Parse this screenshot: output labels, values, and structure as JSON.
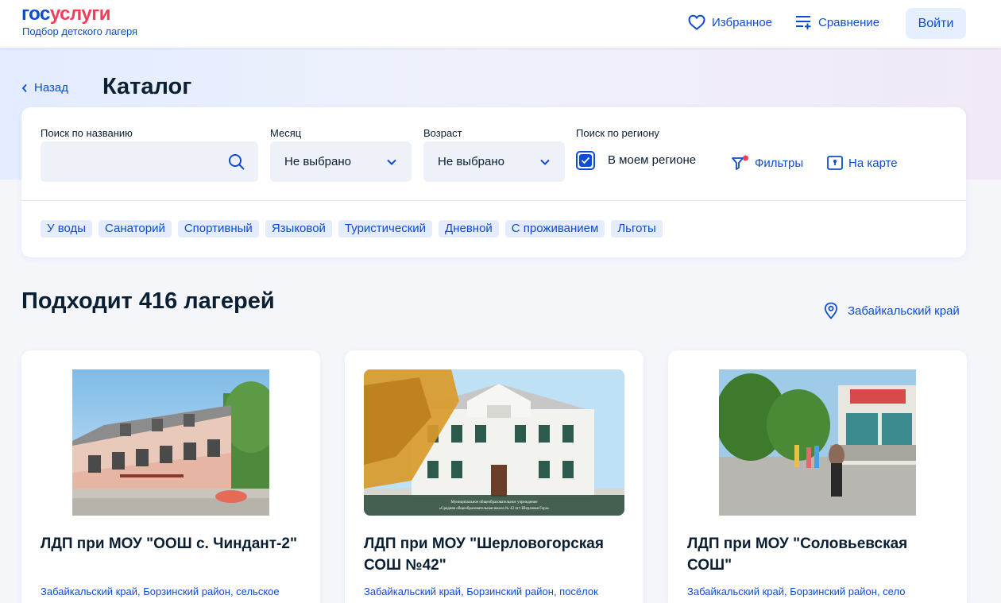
{
  "header": {
    "logo_gos": "гос",
    "logo_uslugi": "услуги",
    "subtitle": "Подбор детского лагеря",
    "favorites_label": "Избранное",
    "compare_label": "Сравнение",
    "login_label": "Войти"
  },
  "nav": {
    "back_label": "Назад",
    "page_title": "Каталог"
  },
  "filters": {
    "search_label": "Поиск по названию",
    "search_value": "",
    "month_label": "Месяц",
    "month_value": "Не выбрано",
    "age_label": "Возраст",
    "age_value": "Не выбрано",
    "region_label": "Поиск по региону",
    "region_checkbox_label": "В моем регионе",
    "region_checked": true,
    "filters_label": "Фильтры",
    "map_label": "На карте",
    "tags": [
      "У воды",
      "Санаторий",
      "Спортивный",
      "Языковой",
      "Туристический",
      "Дневной",
      "С проживанием",
      "Льготы"
    ]
  },
  "results": {
    "title": "Подходит 416 лагерей",
    "region": "Забайкальский край"
  },
  "cards": [
    {
      "title": "ЛДП при МОУ \"ООШ с. Чиндант-2\"",
      "address": "Забайкальский край, Борзинский район, сельское"
    },
    {
      "title": "ЛДП при МОУ \"Шерловогорская СОШ №42\"",
      "address": "Забайкальский край, Борзинский район, посёлок",
      "image_caption_1": "Муниципальное общеобразовательное учреждение",
      "image_caption_2": "«Средняя общеобразовательная школа № 42 пгт Шерловая Гора»"
    },
    {
      "title": "ЛДП при МОУ \"Соловьевская СОШ\"",
      "address": "Забайкальский край, Борзинский район, село"
    }
  ],
  "colors": {
    "brand_blue": "#0d4cd3",
    "brand_red": "#ee3f58",
    "text_dark": "#0b1f33",
    "tag_bg": "#e4ecfd"
  }
}
